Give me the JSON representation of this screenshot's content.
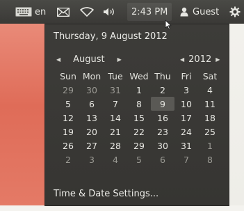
{
  "panel": {
    "keyboard_label": "en",
    "time": "2:43 PM",
    "user": "Guest"
  },
  "calendar": {
    "date_header": "Thursday,  9 August 2012",
    "month": "August",
    "year": "2012",
    "weekdays": [
      "Sun",
      "Mon",
      "Tue",
      "Wed",
      "Thu",
      "Fri",
      "Sat"
    ],
    "weeks": [
      [
        "29",
        "30",
        "31",
        "1",
        "2",
        "3",
        "4"
      ],
      [
        "5",
        "6",
        "7",
        "8",
        "9",
        "10",
        "11"
      ],
      [
        "12",
        "13",
        "14",
        "15",
        "16",
        "17",
        "18"
      ],
      [
        "19",
        "20",
        "21",
        "22",
        "23",
        "24",
        "25"
      ],
      [
        "26",
        "27",
        "28",
        "29",
        "30",
        "31",
        "1"
      ],
      [
        "2",
        "3",
        "4",
        "5",
        "6",
        "7",
        "8"
      ]
    ],
    "settings_label": "Time & Date Settings..."
  },
  "colors": {
    "panel_bg": "#3a3936",
    "menu_bg": "#3d3c39",
    "wallpaper": "#df6c58"
  },
  "icons": [
    "keyboard-icon",
    "mail-icon",
    "wifi-icon",
    "volume-icon",
    "user-icon",
    "power-gear-icon",
    "mouse-cursor-icon"
  ]
}
